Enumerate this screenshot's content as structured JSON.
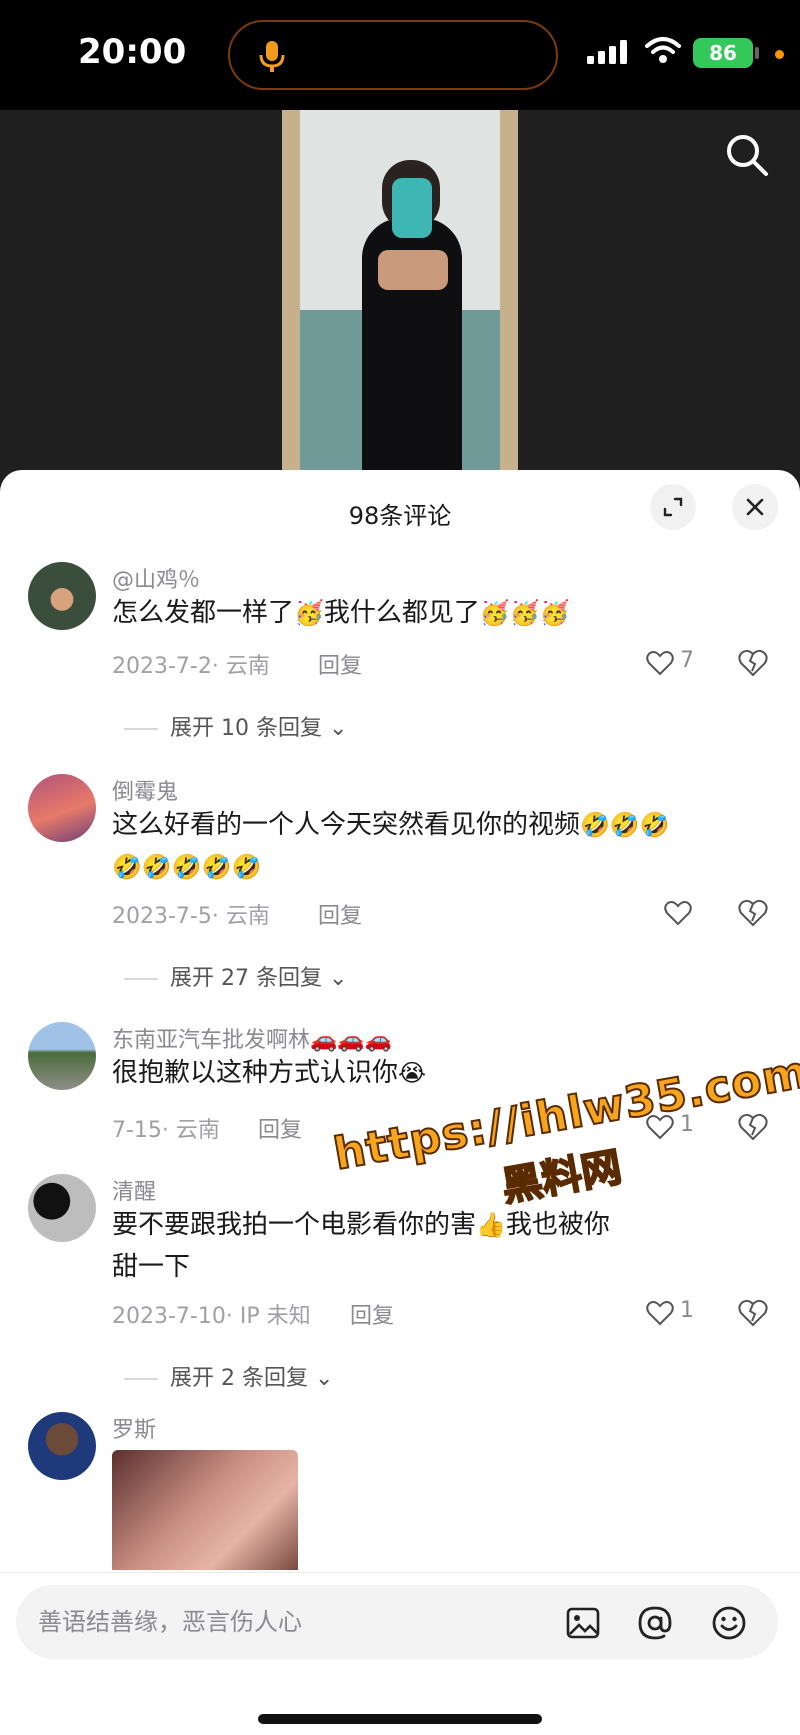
{
  "status_bar": {
    "time": "20:00",
    "battery": "86"
  },
  "sheet": {
    "title": "98条评论"
  },
  "comments": [
    {
      "username": "@山鸡％",
      "text": "怎么发都一样了",
      "text_tail": "我什么都见了",
      "emoji": "🥳",
      "emoji_tail": "🥳🥳🥳",
      "date_location": "2023-7-2· 云南",
      "reply_label": "回复",
      "likes": "7",
      "expand_label": "展开 10 条回复"
    },
    {
      "username": "倒霉鬼",
      "text": "这么好看的一个人今天突然看见你的视频",
      "emoji": "🤣🤣🤣",
      "line2_emoji": "🤣🤣🤣🤣🤣",
      "date_location": "2023-7-5· 云南",
      "reply_label": "回复",
      "likes": "",
      "expand_label": "展开 27 条回复"
    },
    {
      "username": "东南亚汽车批发啊林",
      "username_emoji": "🚗🚗🚗",
      "text": "很抱歉以这种方式认识你",
      "emoji": "😭",
      "date_location": "7-15· 云南",
      "reply_label": "回复",
      "likes": "1"
    },
    {
      "username": "清醒",
      "text": "要不要跟我拍一个电影看你的",
      "text_mid": "害",
      "emoji": "👍",
      "text_tail": "我也被你",
      "line2": "甜一下",
      "date_location": "2023-7-10· IP 未知",
      "reply_label": "回复",
      "likes": "1",
      "expand_label": "展开 2 条回复"
    },
    {
      "username": "罗斯"
    }
  ],
  "watermark": {
    "url": "https://ihlw35.com",
    "name": "黑料网"
  },
  "input": {
    "placeholder": "善语结善缘，恶言伤人心"
  },
  "icons": [
    "microphone-icon",
    "signal-icon",
    "wifi-icon",
    "search-icon",
    "expand-icon",
    "close-icon",
    "heart-icon",
    "dislike-icon",
    "chevron-down-icon",
    "image-icon",
    "at-icon",
    "emoji-icon"
  ],
  "colors": {
    "accent": "#1a1a1a",
    "muted": "#8a8a8f",
    "battery": "#34c759",
    "watermark": "#f7a51c"
  }
}
